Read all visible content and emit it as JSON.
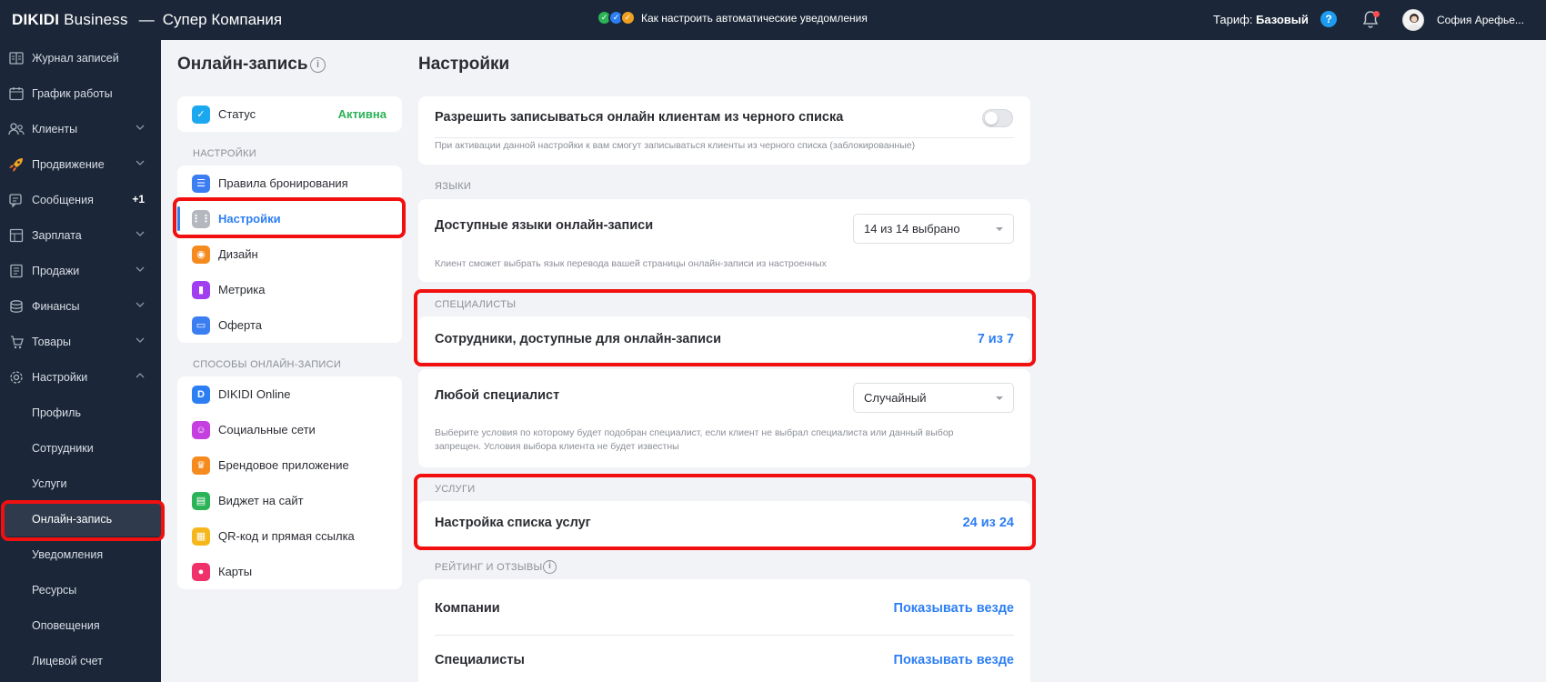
{
  "header": {
    "brand": "DIKIDI",
    "brand_suffix": " Business",
    "separator": "—",
    "company": "Супер Компания",
    "promo_text": "Как настроить автоматические уведомления",
    "tariff_label": "Тариф: ",
    "tariff_value": "Базовый",
    "user_name": "София Арефье...",
    "help_symbol": "?"
  },
  "sidebar": {
    "items": [
      {
        "label": "Журнал записей",
        "icon": "journal-icon"
      },
      {
        "label": "График работы",
        "icon": "calendar-icon"
      },
      {
        "label": "Клиенты",
        "icon": "clients-icon",
        "chevron": "down"
      },
      {
        "label": "Продвижение",
        "icon": "rocket-icon",
        "chevron": "down"
      },
      {
        "label": "Сообщения",
        "icon": "messages-icon",
        "badge": "+1"
      },
      {
        "label": "Зарплата",
        "icon": "salary-icon",
        "chevron": "down"
      },
      {
        "label": "Продажи",
        "icon": "sales-icon",
        "chevron": "down"
      },
      {
        "label": "Финансы",
        "icon": "finance-icon",
        "chevron": "down"
      },
      {
        "label": "Товары",
        "icon": "goods-icon",
        "chevron": "down"
      },
      {
        "label": "Настройки",
        "icon": "gear-icon",
        "chevron": "up"
      }
    ],
    "sub_items": [
      "Профиль",
      "Сотрудники",
      "Услуги",
      "Онлайн-запись",
      "Уведомления",
      "Ресурсы",
      "Оповещения",
      "Лицевой счет"
    ]
  },
  "mid": {
    "title": "Онлайн-запись",
    "status_label": "Статус",
    "status_value": "Активна",
    "settings_section": "НАСТРОЙКИ",
    "settings_items": [
      "Правила бронирования",
      "Настройки",
      "Дизайн",
      "Метрика",
      "Оферта"
    ],
    "ways_section": "СПОСОБЫ ОНЛАЙН-ЗАПИСИ",
    "ways_items": [
      "DIKIDI Online",
      "Социальные сети",
      "Брендовое приложение",
      "Виджет на сайт",
      "QR-код и прямая ссылка",
      "Карты"
    ]
  },
  "main": {
    "title": "Настройки",
    "blacklist_title": "Разрешить записываться онлайн клиентам из черного списка",
    "blacklist_desc": "При активации данной настройки к вам смогут записываться клиенты из черного списка (заблокированные)",
    "languages_section": "ЯЗЫКИ",
    "languages_title": "Доступные языки онлайн-записи",
    "languages_select": "14 из 14 выбрано",
    "languages_desc": "Клиент сможет выбрать язык перевода вашей страницы онлайн-записи из настроенных",
    "specialists_section": "СПЕЦИАЛИСТЫ",
    "employees_title": "Сотрудники, доступные для онлайн-записи",
    "employees_value": "7 из 7",
    "any_specialist_title": "Любой специалист",
    "any_specialist_select": "Случайный",
    "any_specialist_desc": "Выберите условия по которому будет подобран специалист, если клиент не выбрал специалиста или данный выбор запрещен. Условия выбора клиента не будет известны",
    "services_section": "УСЛУГИ",
    "services_title": "Настройка списка услуг",
    "services_value": "24 из 24",
    "rating_section": "РЕЙТИНГ И ОТЗЫВЫ",
    "companies_title": "Компании",
    "companies_value": "Показывать везде",
    "specialists_title": "Специалисты",
    "specialists_value": "Показывать везде"
  },
  "colors": {
    "nav_bg": "#1b2738",
    "accent": "#2c7ef3",
    "active_green": "#2cb358",
    "highlight_red": "#f10f0f"
  }
}
